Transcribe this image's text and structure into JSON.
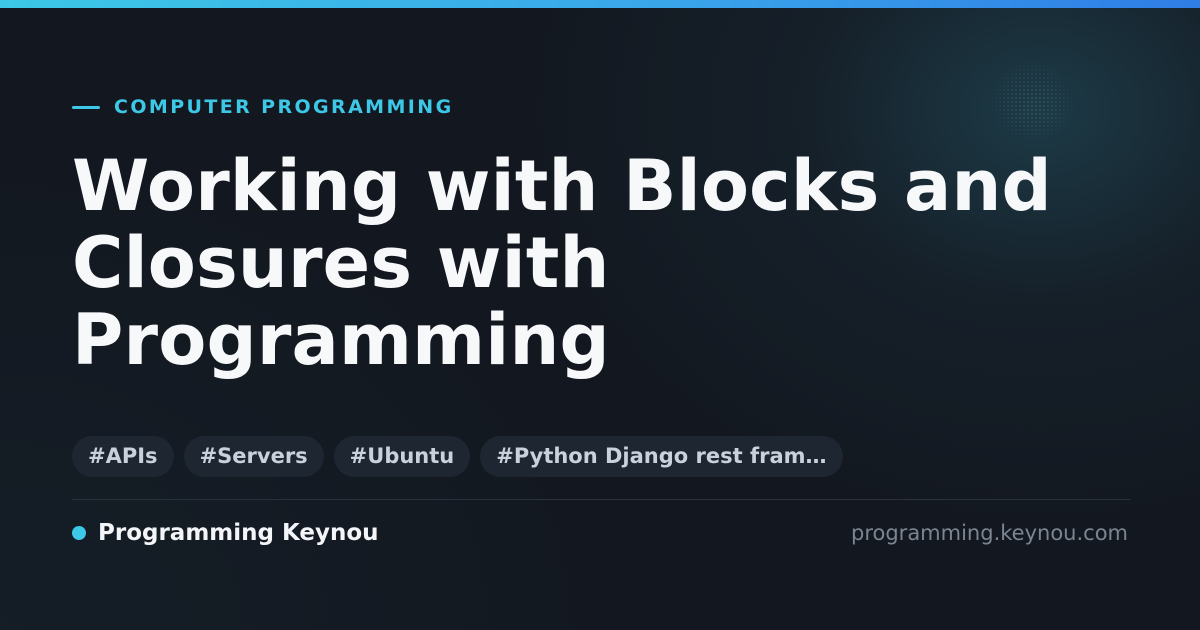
{
  "category": "COMPUTER PROGRAMMING",
  "title_lines": [
    "Working with Blocks and",
    "Closures with",
    "Programming"
  ],
  "tags": [
    "#APIs",
    "#Servers",
    "#Ubuntu",
    "#Python Django rest fram…"
  ],
  "brand": {
    "name": "Programming Keynou",
    "url": "programming.keynou.com"
  },
  "colors": {
    "accent": "#3cc8e6",
    "background": "#131820",
    "title": "#f7f8fa",
    "tag_background": "#1d2631",
    "url_text": "#7b8591"
  },
  "icons": [
    "category-dash-icon",
    "brand-dot-icon",
    "dot-pattern-decoration"
  ]
}
